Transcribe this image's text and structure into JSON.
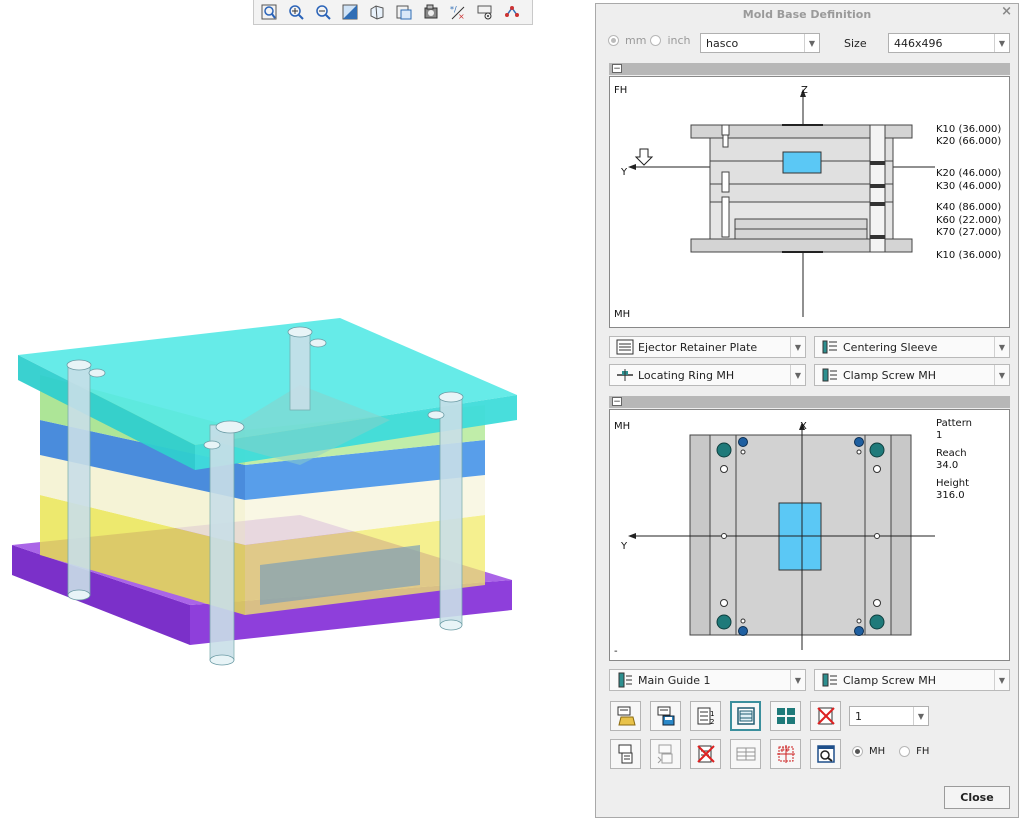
{
  "toolbar": {
    "icons": [
      "refit-icon",
      "zoom-in-icon",
      "zoom-out-icon",
      "display-style-icon",
      "saved-views-icon",
      "view-manager-icon",
      "perspective-icon",
      "annotation-display-icon",
      "spin-center-icon",
      "datum-display-icon"
    ]
  },
  "dialog": {
    "title": "Mold Base Definition",
    "close_glyph": "×",
    "units": {
      "mm": "mm",
      "inch": "inch",
      "selected": "mm"
    },
    "vendor": "hasco",
    "size_label": "Size",
    "size_value": "446x496",
    "upper_panel": {
      "fh_label": "FH",
      "mh_label": "MH",
      "axis_z": "Z",
      "axis_y": "Y",
      "plates": [
        "K10 (36.000)",
        "K20 (66.000)",
        "K20 (46.000)",
        "K30 (46.000)",
        "K40 (86.000)",
        "K60 (22.000)",
        "K70 (27.000)",
        "K10 (36.000)"
      ]
    },
    "combos": {
      "ejector": "Ejector Retainer Plate",
      "centering": "Centering Sleeve",
      "locating": "Locating Ring MH",
      "clamp1": "Clamp Screw MH",
      "guide": "Main Guide 1",
      "clamp2": "Clamp Screw MH"
    },
    "lower_panel": {
      "mh_label": "MH",
      "axis_x": "X",
      "axis_y": "Y",
      "pattern_label": "Pattern",
      "pattern_value": "1",
      "reach_label": "Reach",
      "reach_value": "34.0",
      "height_label": "Height",
      "height_value": "316.0",
      "dash": "-"
    },
    "count_value": "1",
    "side": {
      "mh": "MH",
      "fh": "FH",
      "selected": "MH"
    },
    "close_label": "Close"
  },
  "colors": {
    "top_plate": "#3ee0df",
    "plate_green": "#a6e48c",
    "plate_blue": "#2f86d8",
    "plate_yellow": "#f0ea4a",
    "bottom_plate": "#9246d8",
    "insert": "#5bc8f5"
  }
}
